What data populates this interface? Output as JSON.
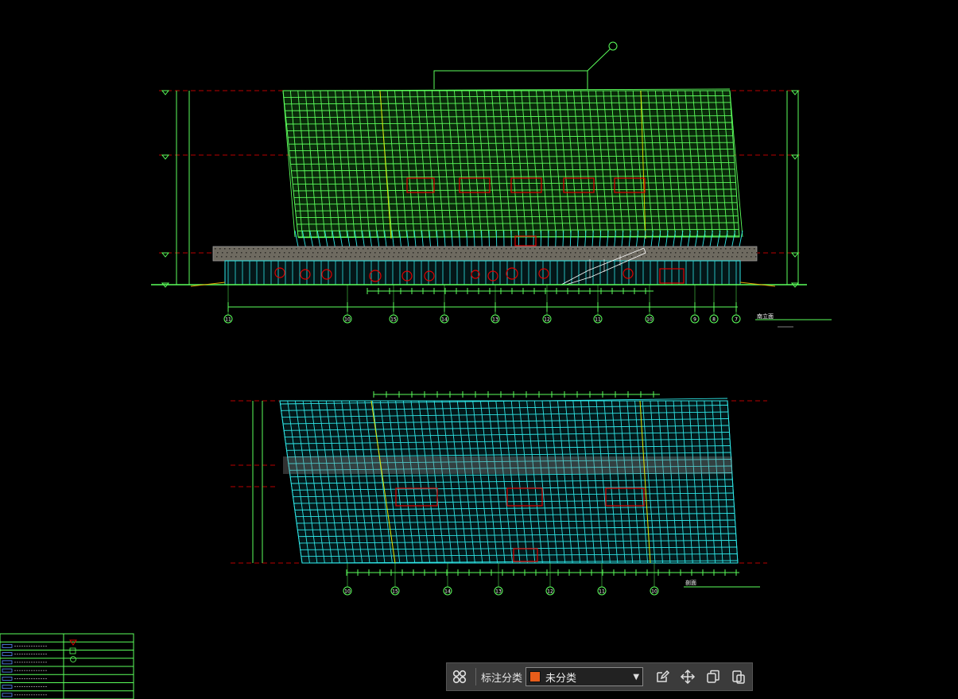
{
  "colors": {
    "background": "#000000",
    "green": "#5bff5b",
    "cyan": "#2ee6e6",
    "red": "#e00000",
    "darkred": "#b80000",
    "yellow": "#e6e600",
    "white": "#ffffff",
    "gray": "#8a8a8a"
  },
  "toolbar": {
    "grid_icon": "grid-four-circles-icon",
    "category_label": "标注分类",
    "category_value": "未分类",
    "category_swatch": "#e85d1a",
    "icons": [
      "edit-icon",
      "move-icon",
      "copy-icon",
      "paste-icon"
    ]
  },
  "drawing": {
    "upper_elevation_grid_labels": [
      "11",
      "10",
      "15",
      "14",
      "13",
      "12",
      "11",
      "10",
      "9",
      "8",
      "7"
    ],
    "upper_elevation_title": "南立面",
    "lower_elevation_grid_labels": [
      "10",
      "15",
      "14",
      "13",
      "12",
      "11",
      "10"
    ],
    "lower_elevation_title": "剖面"
  },
  "legend": {
    "rows": 7
  }
}
